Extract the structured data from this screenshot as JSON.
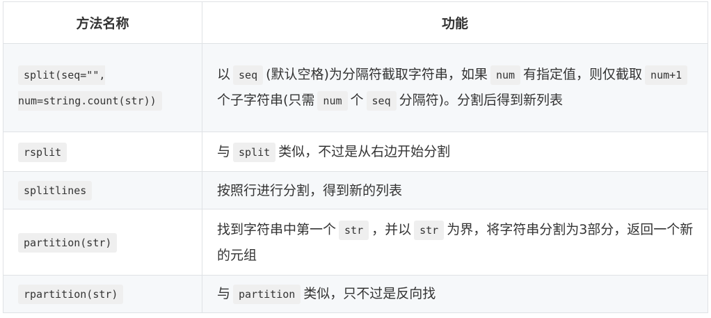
{
  "table": {
    "headers": [
      "方法名称",
      "功能"
    ],
    "rows": [
      {
        "method": "split(seq=\"\", num=string.count(str))",
        "desc": [
          {
            "t": "以"
          },
          {
            "c": "seq"
          },
          {
            "t": "(默认空格)为分隔符截取字符串，如果"
          },
          {
            "c": "num"
          },
          {
            "t": "有指定值，则仅截取"
          },
          {
            "c": "num+1"
          },
          {
            "t": "个子字符串(只需"
          },
          {
            "c": "num"
          },
          {
            "t": "个"
          },
          {
            "c": "seq"
          },
          {
            "t": "分隔符)。分割后得到新列表"
          }
        ]
      },
      {
        "method": "rsplit",
        "desc": [
          {
            "t": "与"
          },
          {
            "c": "split"
          },
          {
            "t": "类似，不过是从右边开始分割"
          }
        ]
      },
      {
        "method": "splitlines",
        "desc": [
          {
            "t": "按照行进行分割，得到新的列表"
          }
        ]
      },
      {
        "method": "partition(str)",
        "desc": [
          {
            "t": "找到字符串中第一个"
          },
          {
            "c": "str"
          },
          {
            "t": "，并以"
          },
          {
            "c": "str"
          },
          {
            "t": "为界，将字符串分割为3部分，返回一个新的元组"
          }
        ]
      },
      {
        "method": "rpartition(str)",
        "desc": [
          {
            "t": "与"
          },
          {
            "c": "partition"
          },
          {
            "t": "类似，只不过是反向找"
          }
        ]
      }
    ]
  }
}
